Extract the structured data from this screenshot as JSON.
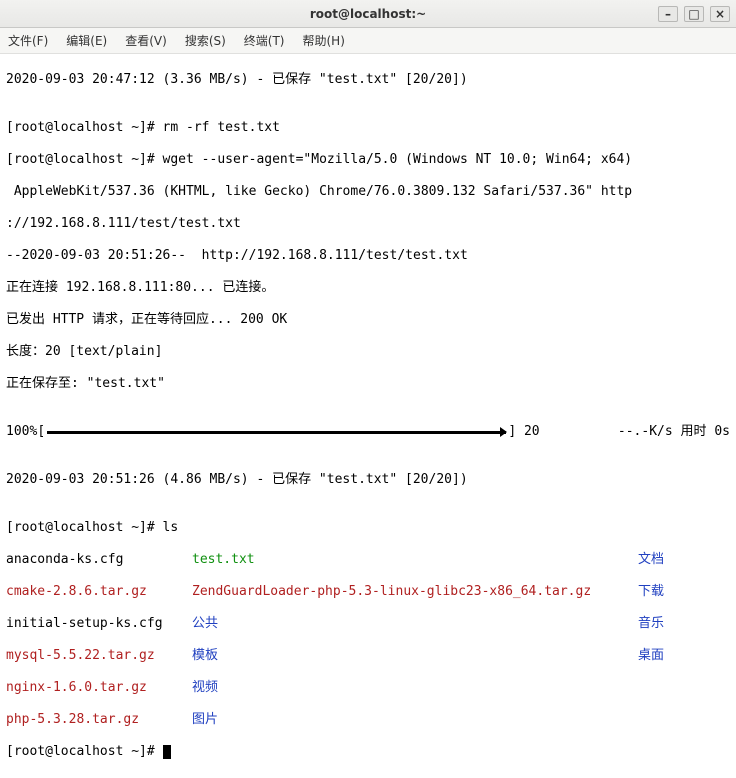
{
  "window": {
    "title": "root@localhost:~",
    "minimize_glyph": "–",
    "maximize_glyph": "□",
    "close_glyph": "×"
  },
  "menu": {
    "file": "文件(F)",
    "edit": "编辑(E)",
    "view": "查看(V)",
    "search": "搜索(S)",
    "terminal": "终端(T)",
    "help": "帮助(H)"
  },
  "term": {
    "line_saved1": "2020-09-03 20:47:12 (3.36 MB/s) - 已保存 \"test.txt\" [20/20])",
    "blank": "",
    "prompt_rm": "[root@localhost ~]# rm -rf test.txt",
    "wget1": "[root@localhost ~]# wget --user-agent=\"Mozilla/5.0 (Windows NT 10.0; Win64; x64)",
    "wget2": " AppleWebKit/537.36 (KHTML, like Gecko) Chrome/76.0.3809.132 Safari/537.36\" http",
    "wget3": "://192.168.8.111/test/test.txt",
    "resolve": "--2020-09-03 20:51:26--  http://192.168.8.111/test/test.txt",
    "connecting": "正在连接 192.168.8.111:80... 已连接。",
    "request": "已发出 HTTP 请求，正在等待回应... 200 OK",
    "length": "长度：20 [text/plain]",
    "saving": "正在保存至: \"test.txt\"",
    "progress_pct": "100%",
    "progress_open": "[",
    "progress_close": "]",
    "progress_right": " 20          --.-K/s 用时 0s",
    "line_saved2": "2020-09-03 20:51:26 (4.86 MB/s) - 已保存 \"test.txt\" [20/20])",
    "prompt_ls": "[root@localhost ~]# ls",
    "ls": {
      "r1c1": "anaconda-ks.cfg",
      "r1c2": "test.txt",
      "r1c3": "文档",
      "r2c1": "cmake-2.8.6.tar.gz",
      "r2c2": "ZendGuardLoader-php-5.3-linux-glibc23-x86_64.tar.gz",
      "r2c3": "下载",
      "r3c1": "initial-setup-ks.cfg",
      "r3c2": "公共",
      "r3c3": "音乐",
      "r4c1": "mysql-5.5.22.tar.gz",
      "r4c2": "模板",
      "r4c3": "桌面",
      "r5c1": "nginx-1.6.0.tar.gz",
      "r5c2": "视频",
      "r6c1": "php-5.3.28.tar.gz",
      "r6c2": "图片"
    },
    "prompt_cursor": "[root@localhost ~]# "
  }
}
